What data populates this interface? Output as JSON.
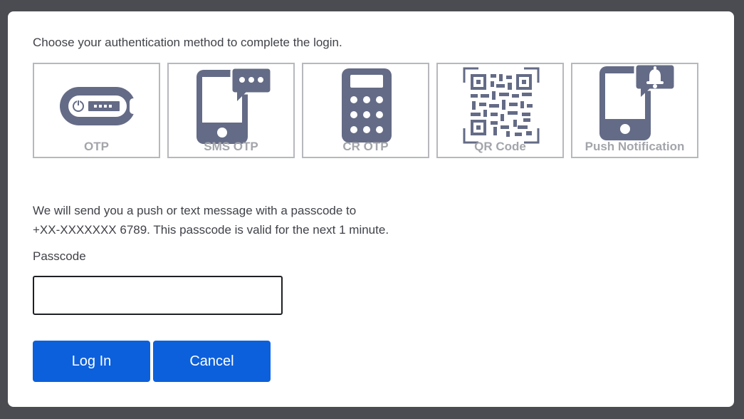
{
  "instructions": "Choose your authentication method to complete the login.",
  "methods": [
    {
      "label": "OTP",
      "icon": "otp-token-icon"
    },
    {
      "label": "SMS OTP",
      "icon": "sms-phone-icon"
    },
    {
      "label": "CR OTP",
      "icon": "calculator-token-icon"
    },
    {
      "label": "QR Code",
      "icon": "qr-code-icon"
    },
    {
      "label": "Push Notification",
      "icon": "push-phone-icon"
    }
  ],
  "message": {
    "line1": "We will send you a push or text message with a passcode to",
    "line2": "+XX-XXXXXXX 6789. This passcode is valid for the next 1 minute."
  },
  "passcode": {
    "label": "Passcode",
    "value": "",
    "placeholder": ""
  },
  "buttons": {
    "login": "Log In",
    "cancel": "Cancel"
  },
  "colors": {
    "icon": "#646b86",
    "accent": "#0c60dc",
    "tile_border": "#b7b8bc",
    "tile_label": "#a3a5ab"
  }
}
